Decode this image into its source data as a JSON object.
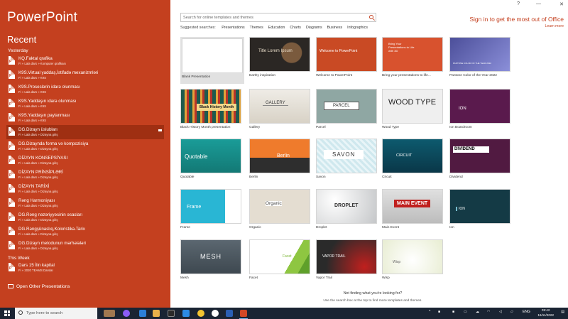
{
  "left": {
    "app_title": "PowerPoint",
    "recent_title": "Recent",
    "group_yesterday": "Yesterday",
    "group_this_week": "This Week",
    "open_other": "Open Other Presentations",
    "recent_items": [
      {
        "name": "KQ.Faktal qrafika",
        "path": "Fi » Lala dars » Komputer qrafikası"
      },
      {
        "name": "K9S.Virtual yaddaş,İstifadə mexanizmləri",
        "path": "Fi » Lala dars » K9S"
      },
      {
        "name": "K9S.Proseslərin idarə olunması",
        "path": "Fi » Lala dars » K9S"
      },
      {
        "name": "K9S.Yaddaşın idarə olunması",
        "path": "Fi » Lala dars » K9S"
      },
      {
        "name": "K9S.Yaddaşın paylanması",
        "path": "Fi » Lala dars » K9S"
      },
      {
        "name": "DG.Dizayn üslubları",
        "path": "Fi » Lala dars » Dizayna giriş"
      },
      {
        "name": "DG.Dizaynda forma və kompozisiya",
        "path": "Fi » Lala dars » Dizayna giriş"
      },
      {
        "name": "DİZAYN KONSEPSİYASI",
        "path": "Fi » Lala dars » Dizayna giriş"
      },
      {
        "name": "DİZAYN PRİNSİPLƏRİ",
        "path": "Fi » Lala dars » Dizayna giriş"
      },
      {
        "name": "DİZAYN TARİXİ",
        "path": "Fi » Lala dars » Dizayna giriş"
      },
      {
        "name": "Rəng Harmoniyası",
        "path": "Fi » Lala dars » Dizayna giriş"
      },
      {
        "name": "DG.Rəng nəzəriyyəsinin əsasları",
        "path": "Fi » Lala dars » Dizayna giriş"
      },
      {
        "name": "DG.Rəngşünaslıq,Koloristika.Tarix",
        "path": "Fi » Lala dars » Dizayna giriş"
      },
      {
        "name": "DG.Dizayn metodunun mərhələləri",
        "path": "Fi » Lala dars » Dizayna giriş"
      }
    ],
    "week_items": [
      {
        "name": "Dars 15 İlin kapital",
        "path": "Fi » 2020 TEAMS Darslar"
      }
    ]
  },
  "right": {
    "search_placeholder": "Search for online templates and themes",
    "suggested_label": "Suggested searches:",
    "suggested": [
      "Presentations",
      "Themes",
      "Education",
      "Charts",
      "Diagrams",
      "Business",
      "Infographics"
    ],
    "signin": "Sign in to get the most out of Office",
    "learn_more": "Learn more",
    "templates": [
      {
        "label": "Blank Presentation",
        "thumb_text": ""
      },
      {
        "label": "Earthy inspiration",
        "thumb_text": "Title Lorem Ipsum"
      },
      {
        "label": "Welcome to PowerPoint",
        "thumb_text": "Welcome to PowerPoint"
      },
      {
        "label": "Bring your presentations to life...",
        "thumb_text": "Bring Your Presentations to Life with 3D"
      },
      {
        "label": "Pantone Color of the Year 2022",
        "thumb_text": "PANTONE COLOR OF THE YEAR 2022"
      },
      {
        "label": "Black History Month presentation",
        "thumb_text": "Black History Month"
      },
      {
        "label": "Gallery",
        "thumb_text": "GALLERY"
      },
      {
        "label": "Parcel",
        "thumb_text": "PARCEL"
      },
      {
        "label": "Wood Type",
        "thumb_text": "WOOD TYPE"
      },
      {
        "label": "Ion Boardroom",
        "thumb_text": "ION"
      },
      {
        "label": "Quotable",
        "thumb_text": "Quotable"
      },
      {
        "label": "Berlin",
        "thumb_text": "Berlin"
      },
      {
        "label": "Savon",
        "thumb_text": "SAVON"
      },
      {
        "label": "Circuit",
        "thumb_text": "CIRCUIT"
      },
      {
        "label": "Dividend",
        "thumb_text": "DIVIDEND"
      },
      {
        "label": "Frame",
        "thumb_text": "Frame"
      },
      {
        "label": "Organic",
        "thumb_text": "Organic"
      },
      {
        "label": "Droplet",
        "thumb_text": "DROPLET"
      },
      {
        "label": "Main Event",
        "thumb_text": "MAIN EVENT"
      },
      {
        "label": "Ion",
        "thumb_text": "ION"
      },
      {
        "label": "Mesh",
        "thumb_text": "MESH"
      },
      {
        "label": "Facet",
        "thumb_text": "Facet"
      },
      {
        "label": "Vapor Trail",
        "thumb_text": "VAPOR TRAIL"
      },
      {
        "label": "Wisp",
        "thumb_text": "Wisp"
      }
    ],
    "footer_question": "Not finding what you're looking for?",
    "footer_desc": "Use the search box at the top to find more templates and themes."
  },
  "window": {
    "help": "?",
    "minimize": "—",
    "close": "✕"
  },
  "taskbar": {
    "search_placeholder": "Type here to search",
    "language": "ENG",
    "time": "09:42",
    "date": "16/11/2022"
  },
  "colors": {
    "accent": "#c4401f",
    "taskbar": "#1a2433"
  }
}
